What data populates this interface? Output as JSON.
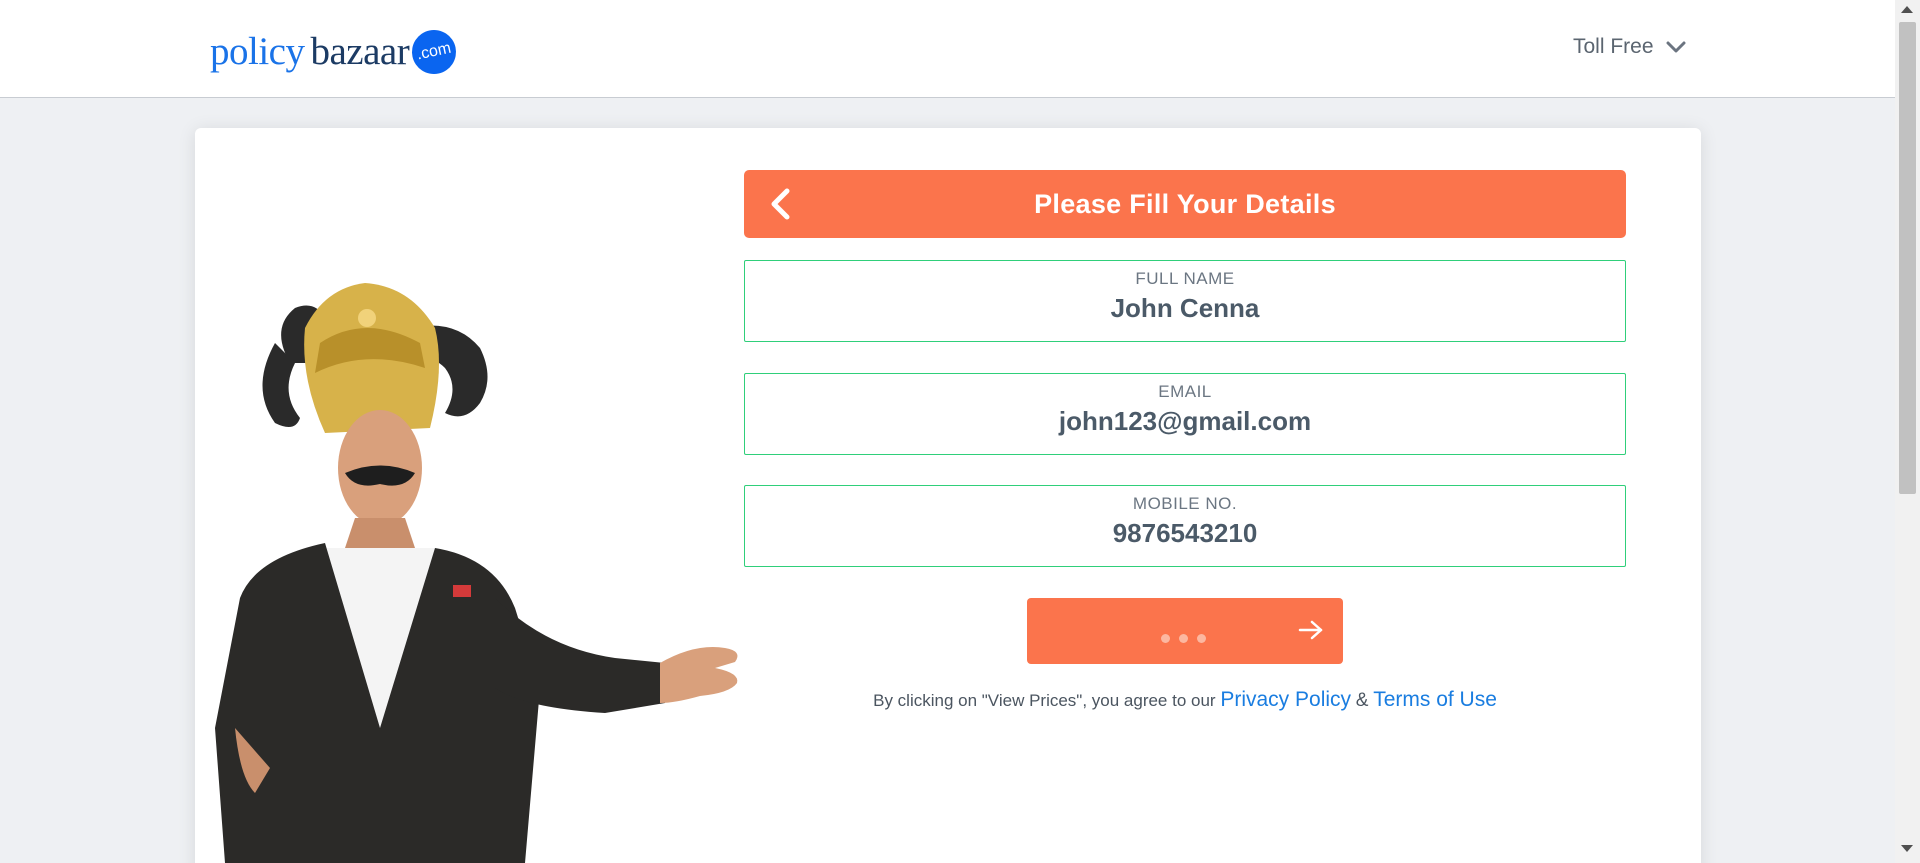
{
  "header": {
    "logo": {
      "part1": "policy",
      "part2": "bazaar",
      "badge": ".com"
    },
    "toll_free_label": "Toll Free"
  },
  "form": {
    "title": "Please Fill Your Details",
    "fields": [
      {
        "label": "FULL NAME",
        "value": "John Cenna"
      },
      {
        "label": "EMAIL",
        "value": "john123@gmail.com"
      },
      {
        "label": "MOBILE NO.",
        "value": "9876543210"
      }
    ],
    "consent": {
      "prefix": "By clicking on \"View Prices\", you agree to our",
      "privacy_link": "Privacy Policy",
      "separator": "&",
      "terms_link": "Terms of Use"
    }
  },
  "colors": {
    "accent": "#fb744c",
    "field_border": "#2fcf7a",
    "link": "#1a7de0",
    "brand_blue": "#0a65f0"
  },
  "icons": {
    "back": "chevron-left-icon",
    "toll_free": "chevron-down-icon",
    "submit": "arrow-right-icon"
  }
}
